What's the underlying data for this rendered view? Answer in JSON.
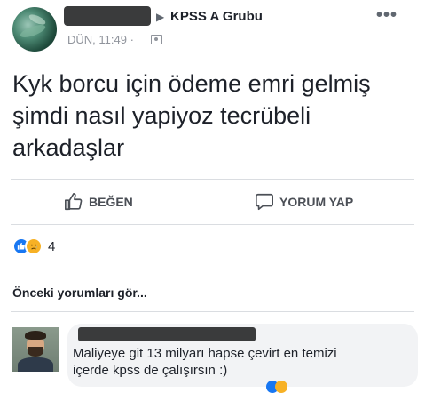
{
  "post": {
    "group_name": "KPSS A Grubu",
    "timestamp": "DÜN, 11:49 ·",
    "more_label": "•••",
    "text_line1": "Kyk borcu için ödeme emri gelmiş",
    "text_line2": "şimdi nasıl yapiyoz tecrübeli",
    "text_line3": "arkadaşlar"
  },
  "actions": {
    "like_label": "BEĞEN",
    "comment_label": "YORUM YAP"
  },
  "reactions": {
    "count": "4"
  },
  "comments": {
    "previous_label": "Önceki yorumları gör...",
    "first": {
      "line1": "Maliyeye git 13 milyarı hapse çevirt en temizi",
      "line2": "içerde kpss de çalışırsın :)"
    }
  },
  "colors": {
    "accent": "#1877f2",
    "sad_reaction": "#f7b125",
    "comment_bg": "#f2f3f5"
  },
  "icons": {
    "like": "thumbs-up-icon",
    "comment": "speech-bubble-icon",
    "arrow": "triangle-right-icon",
    "audience": "group-audience-icon"
  }
}
